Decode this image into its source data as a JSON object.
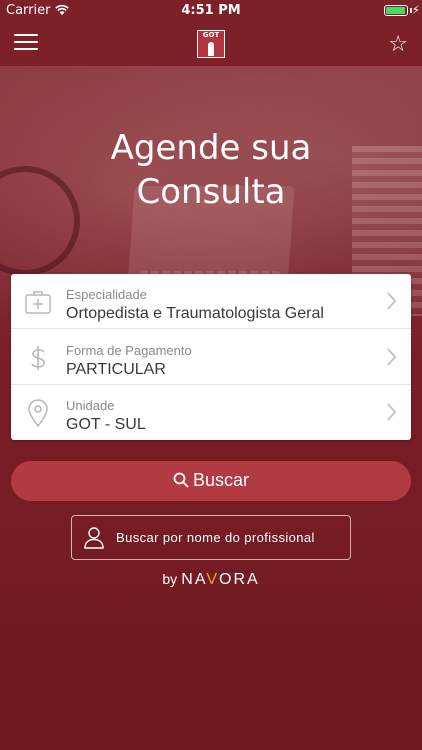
{
  "status_bar": {
    "carrier": "Carrier",
    "time": "4:51 PM",
    "battery_color": "#4cd964"
  },
  "navbar": {
    "menu_icon": "hamburger-menu-icon",
    "logo_text": "GOT",
    "favorite_icon": "star-outline-icon"
  },
  "hero": {
    "title_line1": "Agende sua",
    "title_line2": "Consulta"
  },
  "form": {
    "rows": [
      {
        "icon": "medical-kit-icon",
        "label": "Especialidade",
        "value": "Ortopedista e Traumatologista Geral"
      },
      {
        "icon": "dollar-icon",
        "label": "Forma de Pagamento",
        "value": "PARTICULAR"
      },
      {
        "icon": "location-pin-icon",
        "label": "Unidade",
        "value": "GOT - SUL"
      }
    ]
  },
  "actions": {
    "search_label": "Buscar",
    "professional_search_label": "Buscar por nome do profissional"
  },
  "footer": {
    "by": "by",
    "brand": "NAVORA"
  },
  "colors": {
    "primary": "#7d2028",
    "button": "#b23a42",
    "accent": "#e9a23b"
  }
}
